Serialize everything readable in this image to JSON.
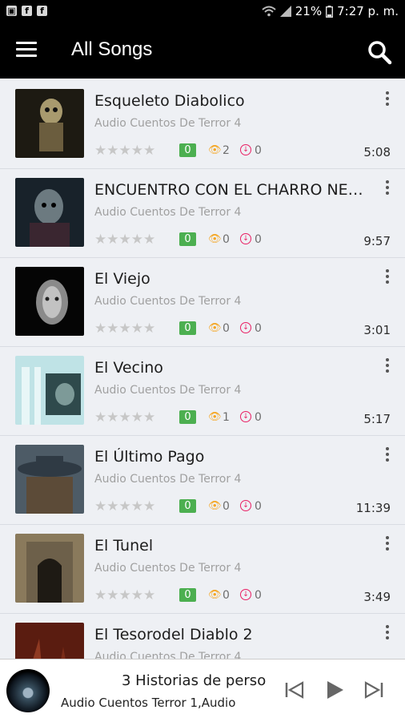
{
  "status_bar": {
    "battery": "21%",
    "time": "7:27 p. m.",
    "icons": [
      "photo-icon",
      "facebook-icon",
      "facebook-icon",
      "wifi-icon",
      "signal-icon",
      "battery-icon"
    ]
  },
  "app_bar": {
    "title": "All Songs",
    "menu_icon": "hamburger-menu-icon",
    "search_icon": "search-icon"
  },
  "songs": [
    {
      "title": "Esqueleto Diabolico",
      "album": "Audio Cuentos De Terror 4",
      "rating_badge": "0",
      "views": "2",
      "downloads": "0",
      "duration": "5:08"
    },
    {
      "title": "ENCUENTRO CON EL CHARRO NE…",
      "album": "Audio Cuentos De Terror 4",
      "rating_badge": "0",
      "views": "0",
      "downloads": "0",
      "duration": "9:57"
    },
    {
      "title": "El Viejo",
      "album": "Audio Cuentos De Terror 4",
      "rating_badge": "0",
      "views": "0",
      "downloads": "0",
      "duration": "3:01"
    },
    {
      "title": "El Vecino",
      "album": "Audio Cuentos De Terror 4",
      "rating_badge": "0",
      "views": "1",
      "downloads": "0",
      "duration": "5:17"
    },
    {
      "title": "El Último Pago",
      "album": "Audio Cuentos De Terror 4",
      "rating_badge": "0",
      "views": "0",
      "downloads": "0",
      "duration": "11:39"
    },
    {
      "title": "El Tunel",
      "album": "Audio Cuentos De Terror 4",
      "rating_badge": "0",
      "views": "0",
      "downloads": "0",
      "duration": "3:49"
    },
    {
      "title": "El Tesorodel Diablo 2",
      "album": "Audio Cuentos De Terror 4",
      "rating_badge": "",
      "views": "",
      "downloads": "",
      "duration": ""
    }
  ],
  "player": {
    "title": "3 Historias de perso",
    "album": "Audio Cuentos Terror 1,Audio",
    "controls": [
      "skip-previous-icon",
      "play-icon",
      "skip-next-icon"
    ]
  },
  "colors": {
    "app_bar": "#000000",
    "background": "#eef0f4",
    "badge_green": "#4caf50",
    "eye_orange": "#f5a623",
    "download_pink": "#e91e63"
  }
}
